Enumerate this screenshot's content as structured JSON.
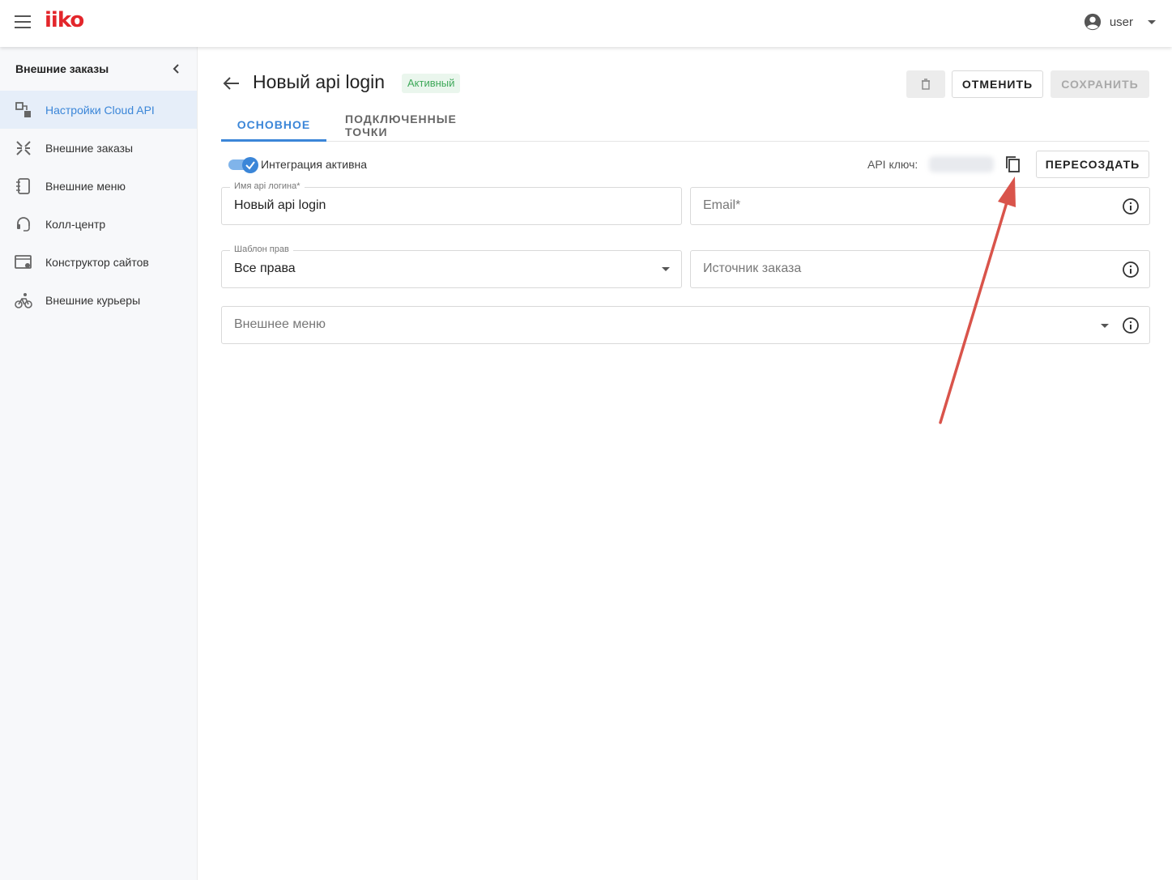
{
  "header": {
    "logo": "iiko",
    "user": {
      "name": "user"
    }
  },
  "sidebar": {
    "title": "Внешние заказы",
    "items": [
      {
        "label": "Настройки Cloud API",
        "icon": "cloud-api-settings-icon",
        "active": true
      },
      {
        "label": "Внешние заказы",
        "icon": "external-orders-icon",
        "active": false
      },
      {
        "label": "Внешние меню",
        "icon": "external-menu-icon",
        "active": false
      },
      {
        "label": "Колл-центр",
        "icon": "headset-icon",
        "active": false
      },
      {
        "label": "Конструктор сайтов",
        "icon": "site-builder-icon",
        "active": false
      },
      {
        "label": "Внешние курьеры",
        "icon": "courier-bike-icon",
        "active": false
      }
    ]
  },
  "page": {
    "title": "Новый api login",
    "status": "Активный",
    "buttons": {
      "cancel": "ОТМЕНИТЬ",
      "save": "СОХРАНИТЬ",
      "regenerate": "ПЕРЕСОЗДАТЬ"
    },
    "tabs": [
      {
        "label": "ОСНОВНОЕ",
        "active": true
      },
      {
        "label": "ПОДКЛЮЧЕННЫЕ ТОЧКИ",
        "active": false
      }
    ],
    "integration_toggle": {
      "label": "Интеграция активна",
      "on": true
    },
    "api_key_label": "API ключ:",
    "fields": {
      "login": {
        "label": "Имя api логина*",
        "value": "Новый api login"
      },
      "email": {
        "placeholder": "Email*"
      },
      "rights": {
        "label": "Шаблон прав",
        "value": "Все права"
      },
      "source": {
        "placeholder": "Источник заказа"
      },
      "menu": {
        "placeholder": "Внешнее меню"
      }
    }
  },
  "colors": {
    "accent": "#3b86d8",
    "brand": "#e3262b",
    "active_status": "#3fa95a",
    "annotation_arrow": "#d9544b"
  }
}
